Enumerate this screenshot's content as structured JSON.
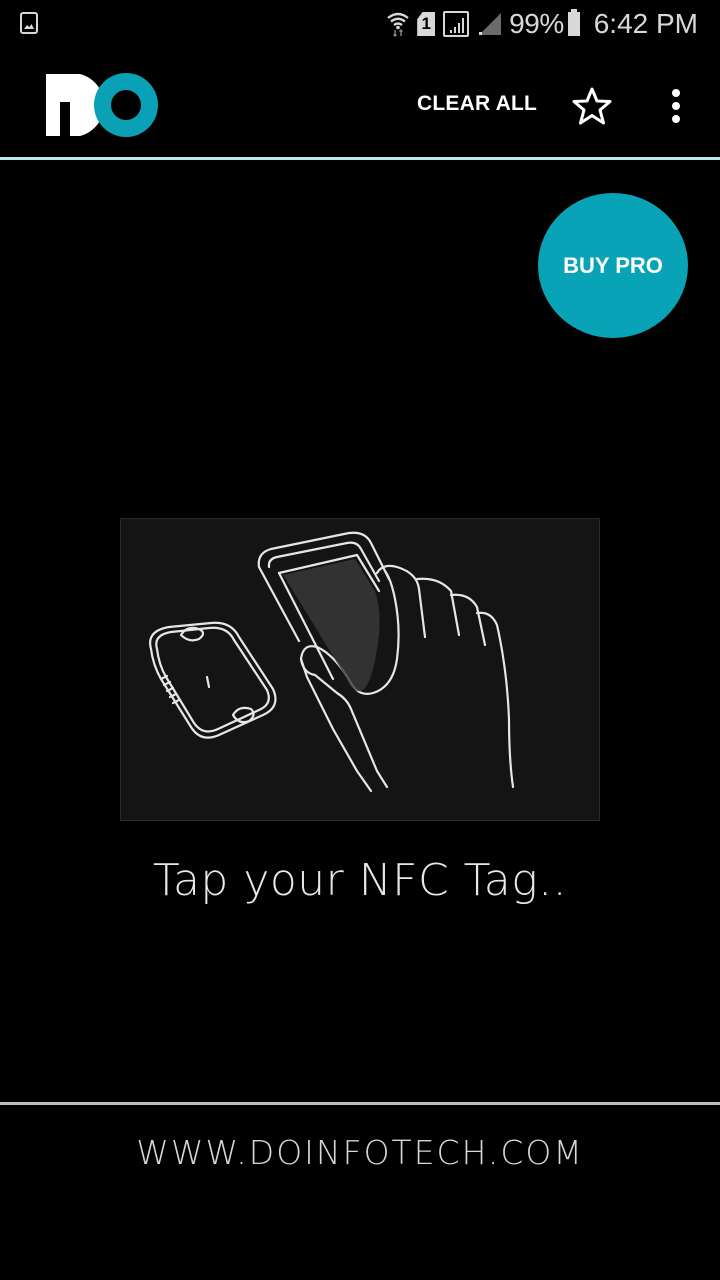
{
  "status_bar": {
    "left_icon": "gallery-notification-icon",
    "icons": [
      "wifi-icon",
      "sim-1-icon",
      "signal-icon",
      "signal-secondary-icon",
      "battery-icon"
    ],
    "sim_label": "1",
    "battery_percent": "99%",
    "time": "6:42 PM"
  },
  "app_bar": {
    "logo_text": "DO",
    "clear_all_label": "CLEAR ALL",
    "star_icon": "star-outline-icon",
    "overflow_icon": "more-vertical-icon",
    "divider_color": "#bfe6ea"
  },
  "buy_pro": {
    "label": "BUY PRO",
    "color": "#08a3b7"
  },
  "main": {
    "illustration": "hand-tapping-phone-on-nfc-tag",
    "prompt": "Tap your NFC Tag.."
  },
  "footer": {
    "link": "WWW.DOINFOTECH.COM"
  },
  "colors": {
    "accent": "#08a3b7",
    "background": "#000000",
    "text": "#ffffff"
  }
}
